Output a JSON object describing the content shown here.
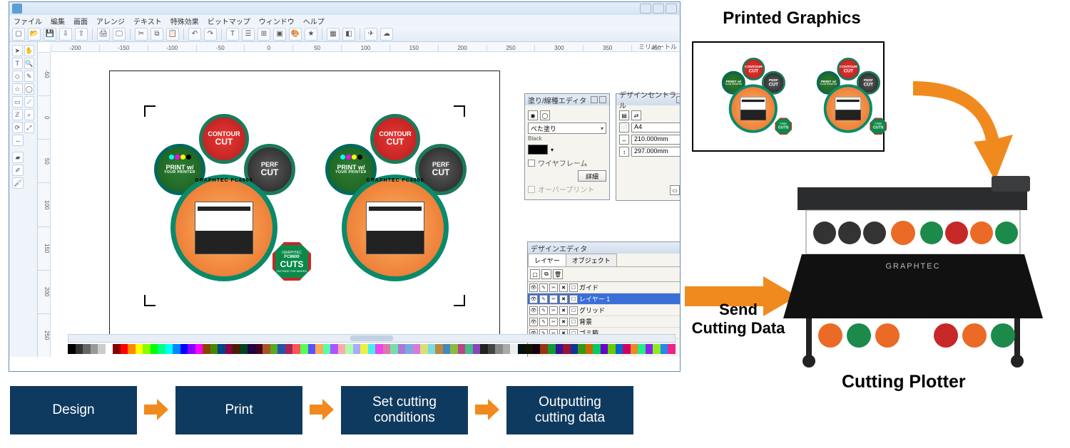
{
  "menubar": [
    "ファイル",
    "編集",
    "画面",
    "アレンジ",
    "テキスト",
    "特殊効果",
    "ビットマップ",
    "ウィンドウ",
    "ヘルプ"
  ],
  "ruler_top": [
    "-200",
    "-150",
    "-100",
    "-50",
    "0",
    "50",
    "100",
    "150",
    "200",
    "250",
    "300",
    "350",
    "400"
  ],
  "ruler_label_top": "ミリメートル",
  "ruler_left": [
    "-50",
    "0",
    "50",
    "100",
    "150",
    "200",
    "250"
  ],
  "sticker": {
    "contour_top": "CONTOUR",
    "contour_big": "CUT",
    "print_top": "PRINT w/",
    "print_sub": "YOUR PRINTER",
    "perf_top": "PERF",
    "perf_big": "CUT",
    "arc": "GRAPHTEC FC8600",
    "oct_t1": "GRAPHTEC",
    "oct_t2": "FC8600",
    "oct_t3": "CUTS",
    "oct_t4": "OUTSIDE THE MARKS"
  },
  "panel_fill": {
    "title": "塗り/線種エディタ",
    "fill_mode": "べた塗り",
    "color_name": "Black",
    "wireframe": "ワイヤフレーム",
    "details_btn": "詳細",
    "overprint": "オーバープリント"
  },
  "panel_central": {
    "title": "デザインセントラル",
    "paper": "A4",
    "width": "210.000mm",
    "height": "297.000mm"
  },
  "panel_editor": {
    "title": "デザインエディタ",
    "tab_layer": "レイヤー",
    "tab_object": "オブジェクト",
    "layers": [
      {
        "name": "ガイド",
        "color": "#3a6fd8",
        "sel": false
      },
      {
        "name": "レイヤー 1",
        "color": "#d22",
        "sel": true
      },
      {
        "name": "グリッド",
        "color": "#3a6fd8",
        "sel": false
      },
      {
        "name": "背景",
        "color": "#ffffff",
        "sel": false
      },
      {
        "name": "ゴミ箱",
        "color": "#ffffff",
        "sel": false
      }
    ]
  },
  "color_bar": [
    "#000",
    "#333",
    "#666",
    "#999",
    "#ccc",
    "#fff",
    "#800",
    "#f00",
    "#f80",
    "#ff0",
    "#8f0",
    "#0f0",
    "#0f8",
    "#0ff",
    "#08f",
    "#00f",
    "#80f",
    "#f0f",
    "#840",
    "#480",
    "#048",
    "#804",
    "#420",
    "#042",
    "#204",
    "#402",
    "#a52",
    "#5a2",
    "#25a",
    "#a25",
    "#f55",
    "#5f5",
    "#55f",
    "#fa5",
    "#5fa",
    "#a5f",
    "#faa",
    "#afa",
    "#aaf",
    "#ee4",
    "#4ee",
    "#e4e",
    "#d7a",
    "#7da",
    "#a7d",
    "#7ad",
    "#d7d",
    "#dd7",
    "#7dd",
    "#b84",
    "#48b",
    "#8b4",
    "#b48",
    "#4b8",
    "#84b",
    "#222",
    "#444",
    "#888",
    "#aaa",
    "#eee",
    "#011",
    "#110",
    "#101",
    "#931",
    "#193",
    "#319",
    "#913",
    "#139",
    "#391",
    "#c60",
    "#0c6",
    "#60c",
    "#6c0",
    "#06c",
    "#c06",
    "#e82",
    "#2e8",
    "#82e",
    "#8e2",
    "#28e",
    "#e28"
  ],
  "diagram": {
    "printed_graphics": "Printed Graphics",
    "send_cutting_data": "Send\nCutting Data",
    "cutting_plotter": "Cutting Plotter"
  },
  "workflow": [
    "Design",
    "Print",
    "Set cutting\nconditions",
    "Outputting\ncutting data"
  ]
}
